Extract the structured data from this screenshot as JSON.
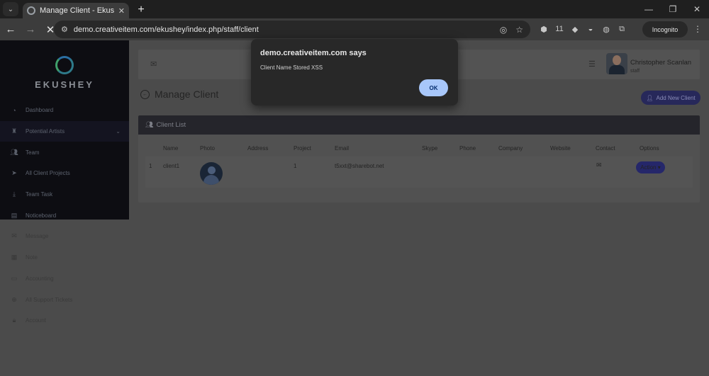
{
  "browser": {
    "tab_title": "Manage Client - Ekushey Project",
    "tab_close": "✕",
    "new_tab": "+",
    "url": "demo.creativeitem.com/ekushey/index.php/staff/client",
    "incognito_label": "Incognito",
    "ext_badge": "11"
  },
  "sidebar": {
    "brand": "EKUSHEY",
    "items": [
      {
        "label": "Dashboard",
        "icon": "gauge-icon"
      },
      {
        "label": "Potential Artists",
        "icon": "trophy-icon"
      },
      {
        "label": "Team",
        "icon": "users-icon"
      },
      {
        "label": "All Client Projects",
        "icon": "send-icon"
      },
      {
        "label": "Team Task",
        "icon": "download-icon"
      },
      {
        "label": "Noticeboard",
        "icon": "board-icon"
      },
      {
        "label": "Message",
        "icon": "envelope-icon"
      },
      {
        "label": "Note",
        "icon": "note-icon"
      },
      {
        "label": "Accounting",
        "icon": "card-icon"
      },
      {
        "label": "All Support Tickets",
        "icon": "lifebuoy-icon"
      },
      {
        "label": "Account",
        "icon": "lock-icon"
      }
    ]
  },
  "header": {
    "user_name": "Christopher Scanlan",
    "user_role": "staff"
  },
  "main": {
    "title": "Manage Client",
    "add_button": "Add New Client",
    "card_title": "Client List",
    "columns": [
      "Name",
      "Photo",
      "Address",
      "Project",
      "Email",
      "Skype",
      "Phone",
      "Company",
      "Website",
      "Contact",
      "Options"
    ],
    "rows": [
      {
        "index": "1",
        "name": "client1",
        "address": "",
        "project": "1",
        "email": "t5xxt@sharebot.net",
        "skype": "",
        "phone": "",
        "company": "",
        "website": "",
        "action_label": "Action ▾"
      }
    ]
  },
  "dialog": {
    "origin": "demo.creativeitem.com says",
    "message": "Client Name Stored XSS",
    "ok_label": "OK"
  }
}
